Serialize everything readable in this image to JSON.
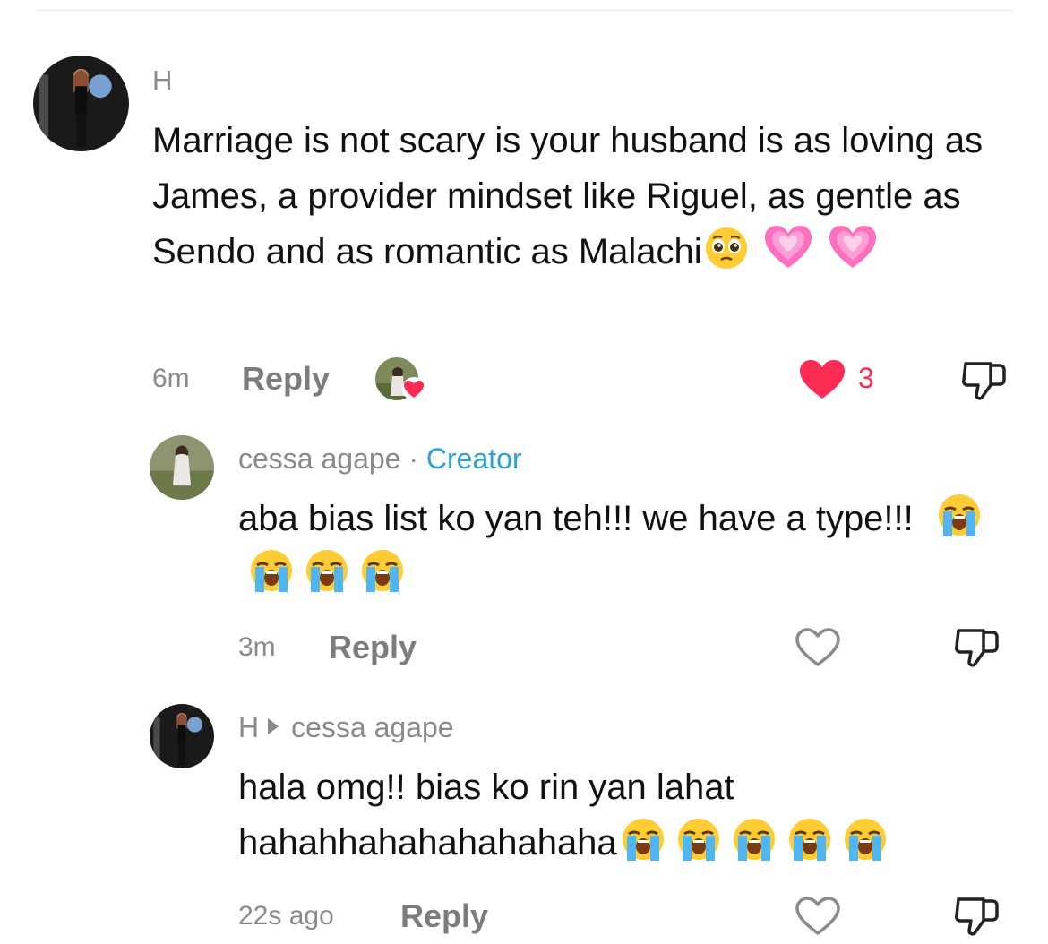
{
  "colors": {
    "accent_like": "#fe2c55",
    "creator": "#2aa3d3",
    "meta": "#8a8a8a"
  },
  "comments": [
    {
      "username": "H",
      "text": "Marriage is not scary is your husband is as loving as James, a provider mindset like Riguel, as gentle as Sendo and as romantic as Malachi",
      "emojis": [
        "pleading-face",
        "growing-heart",
        "growing-heart"
      ],
      "time": "6m",
      "reply_label": "Reply",
      "liked_by_creator": true,
      "liked": true,
      "like_count": "3"
    },
    {
      "username": "cessa agape",
      "separator": "·",
      "badge": "Creator",
      "text": "aba bias list ko yan teh!!! we have a type!!!",
      "emojis": [
        "loudly-crying-face",
        "loudly-crying-face",
        "loudly-crying-face",
        "loudly-crying-face"
      ],
      "time": "3m",
      "reply_label": "Reply",
      "liked": false
    },
    {
      "username": "H",
      "reply_to": "cessa agape",
      "text": "hala omg!! bias ko rin yan lahat hahahhahahahahahaha",
      "emojis": [
        "loudly-crying-face",
        "loudly-crying-face",
        "loudly-crying-face",
        "loudly-crying-face",
        "loudly-crying-face"
      ],
      "time": "22s ago",
      "reply_label": "Reply",
      "liked": false
    }
  ]
}
